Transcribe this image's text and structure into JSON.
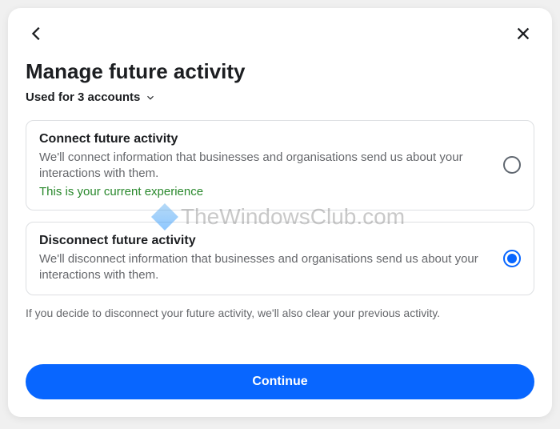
{
  "header": {
    "title": "Manage future activity",
    "subtitle": "Used for 3 accounts"
  },
  "options": {
    "connect": {
      "title": "Connect future activity",
      "desc": "We'll connect information that businesses and organisations send us about your interactions with them.",
      "note": "This is your current experience"
    },
    "disconnect": {
      "title": "Disconnect future activity",
      "desc": "We'll disconnect information that businesses and organisations send us about your interactions with them."
    }
  },
  "info_text": "If you decide to disconnect your future activity, we'll also clear your previous activity.",
  "continue_label": "Continue",
  "watermark": "TheWindowsClub.com"
}
